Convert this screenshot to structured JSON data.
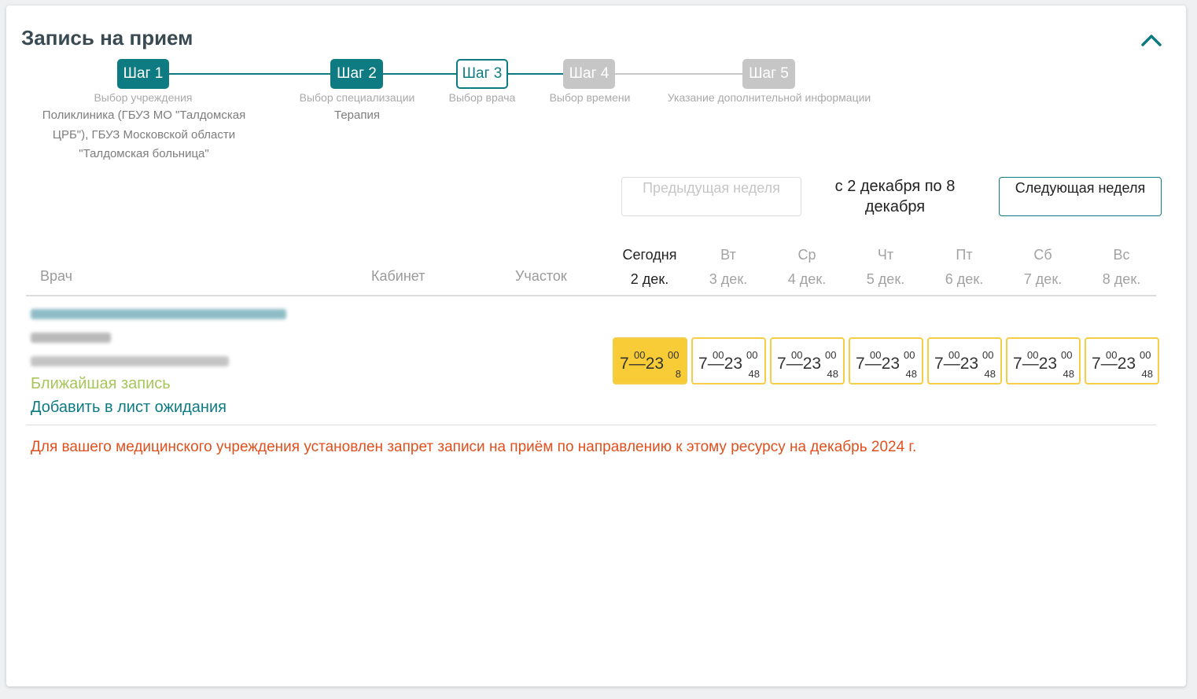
{
  "header": {
    "title": "Запись на прием"
  },
  "steps": [
    {
      "label": "Шаг 1",
      "caption": "Выбор учреждения",
      "value": "Поликлиника (ГБУЗ МО \"Талдомская ЦРБ\"), ГБУЗ Московской области \"Талдомская больница\"",
      "state": "done"
    },
    {
      "label": "Шаг 2",
      "caption": "Выбор специализации",
      "value": "Терапия",
      "state": "done"
    },
    {
      "label": "Шаг 3",
      "caption": "Выбор врача",
      "value": "",
      "state": "current"
    },
    {
      "label": "Шаг 4",
      "caption": "Выбор времени",
      "value": "",
      "state": "todo"
    },
    {
      "label": "Шаг 5",
      "caption": "Указание дополнительной информации",
      "value": "",
      "state": "todo"
    }
  ],
  "week_nav": {
    "prev_label": "Предыдущая неделя",
    "range": "с 2 декабря по 8 декабря",
    "next_label": "Следующая неделя"
  },
  "table": {
    "col_doctor": "Врач",
    "col_cabinet": "Кабинет",
    "col_area": "Участок",
    "days": [
      {
        "dow": "Сегодня",
        "date": "2 дек."
      },
      {
        "dow": "Вт",
        "date": "3 дек."
      },
      {
        "dow": "Ср",
        "date": "4 дек."
      },
      {
        "dow": "Чт",
        "date": "5 дек."
      },
      {
        "dow": "Пт",
        "date": "6 дек."
      },
      {
        "dow": "Сб",
        "date": "7 дек."
      },
      {
        "dow": "Вс",
        "date": "8 дек."
      }
    ]
  },
  "doctor": {
    "nearest_label": "Ближайшая запись",
    "waitlist_label": "Добавить в лист ожидания",
    "slots": [
      {
        "from": "7",
        "from_min": "00",
        "to": "23",
        "to_min": "00",
        "count": "8",
        "active": true
      },
      {
        "from": "7",
        "from_min": "00",
        "to": "23",
        "to_min": "00",
        "count": "48",
        "active": false
      },
      {
        "from": "7",
        "from_min": "00",
        "to": "23",
        "to_min": "00",
        "count": "48",
        "active": false
      },
      {
        "from": "7",
        "from_min": "00",
        "to": "23",
        "to_min": "00",
        "count": "48",
        "active": false
      },
      {
        "from": "7",
        "from_min": "00",
        "to": "23",
        "to_min": "00",
        "count": "48",
        "active": false
      },
      {
        "from": "7",
        "from_min": "00",
        "to": "23",
        "to_min": "00",
        "count": "48",
        "active": false
      },
      {
        "from": "7",
        "from_min": "00",
        "to": "23",
        "to_min": "00",
        "count": "48",
        "active": false
      }
    ]
  },
  "warning": "Для вашего медицинского учреждения установлен запрет записи на приём по направлению к этому ресурсу на декабрь 2024 г.",
  "colors": {
    "accent": "#0e7b83",
    "slot_active": "#f8cc36",
    "slot_border": "#f5cd47",
    "nearest": "#a7c65a",
    "warning": "#e0501e"
  }
}
